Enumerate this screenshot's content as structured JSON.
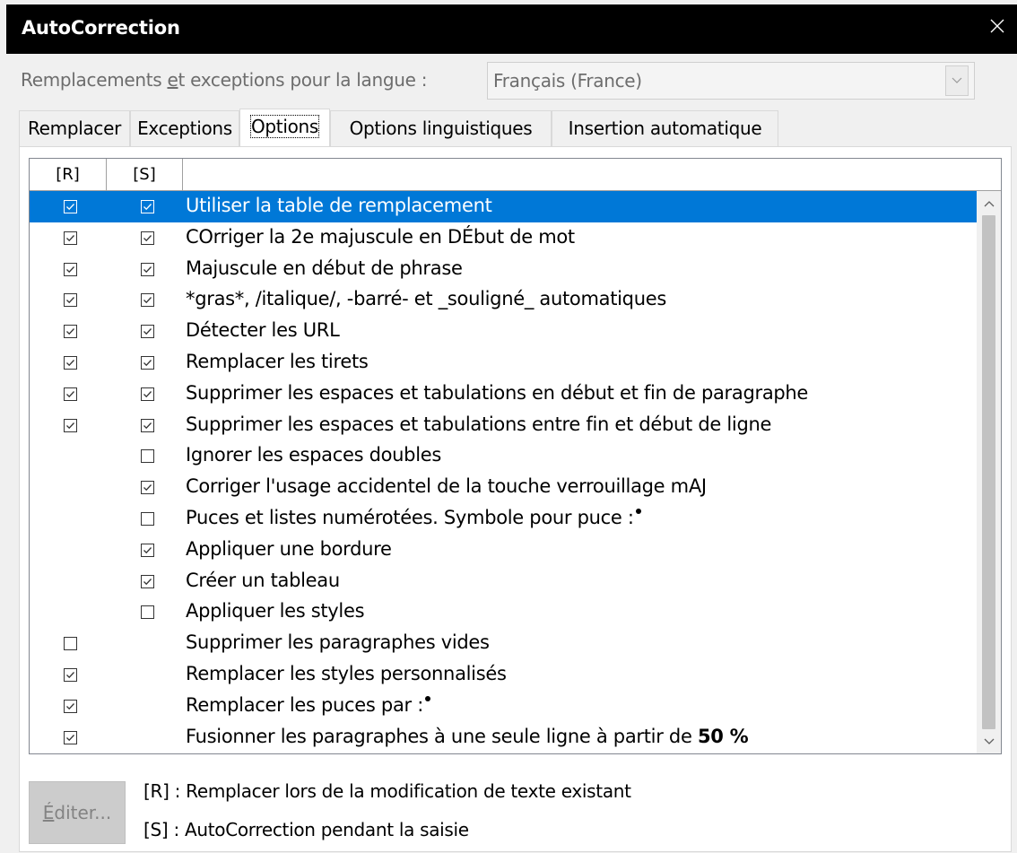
{
  "window": {
    "title": "AutoCorrection",
    "close_icon": "close-icon"
  },
  "language": {
    "label_pre": "Remplacements ",
    "label_u": "e",
    "label_post": "t exceptions pour la langue :",
    "value": "Français (France)"
  },
  "tabs": [
    {
      "label": "Remplacer"
    },
    {
      "label": "Exceptions"
    },
    {
      "label": "Options",
      "active": true
    },
    {
      "label": "Options linguistiques"
    },
    {
      "label": "Insertion automatique"
    }
  ],
  "columns": {
    "r": "[R]",
    "s": "[S]"
  },
  "options": [
    {
      "label": "Utiliser la table de remplacement",
      "r": true,
      "s": true,
      "selected": true
    },
    {
      "label": "COrriger la 2e majuscule en DÉbut de mot",
      "r": true,
      "s": true
    },
    {
      "label": "Majuscule en début de phrase",
      "r": true,
      "s": true
    },
    {
      "label": "*gras*, /italique/, -barré- et _souligné_ automatiques",
      "r": true,
      "s": true
    },
    {
      "label": "Détecter les URL",
      "r": true,
      "s": true
    },
    {
      "label": "Remplacer les tirets",
      "r": true,
      "s": true
    },
    {
      "label": "Supprimer les espaces et tabulations en début et fin de paragraphe",
      "r": true,
      "s": true
    },
    {
      "label": "Supprimer les espaces et tabulations entre fin et début de ligne",
      "r": true,
      "s": true
    },
    {
      "label": "Ignorer les espaces doubles",
      "r": null,
      "s": false
    },
    {
      "label": "Corriger l'usage accidentel de la touche verrouillage mAJ",
      "r": null,
      "s": true
    },
    {
      "label": "Puces et listes numérotées. Symbole pour puce :",
      "r": null,
      "s": false,
      "bullet": true
    },
    {
      "label": "Appliquer une bordure",
      "r": null,
      "s": true
    },
    {
      "label": "Créer un tableau",
      "r": null,
      "s": true
    },
    {
      "label": "Appliquer les styles",
      "r": null,
      "s": false
    },
    {
      "label": "Supprimer les paragraphes vides",
      "r": false,
      "s": null
    },
    {
      "label": "Remplacer les styles personnalisés",
      "r": true,
      "s": null
    },
    {
      "label": "Remplacer les puces par :",
      "r": true,
      "s": null,
      "bullet": true
    },
    {
      "label": "Fusionner les paragraphes à une seule ligne à partir de ",
      "bold_suffix": "50 %",
      "r": true,
      "s": null
    }
  ],
  "edit_button": {
    "underline": "É",
    "rest": "diter..."
  },
  "legend": {
    "r": "[R] : Remplacer lors de la modification de texte existant",
    "s": "[S] : AutoCorrection pendant la saisie"
  }
}
